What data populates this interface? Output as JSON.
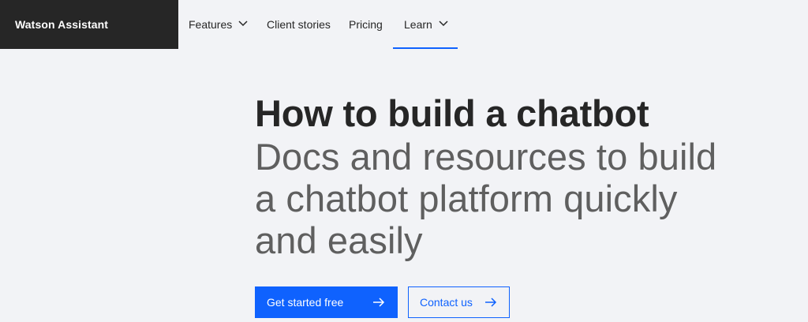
{
  "header": {
    "brand": "Watson Assistant",
    "nav": {
      "features": "Features",
      "client_stories": "Client stories",
      "pricing": "Pricing",
      "learn": "Learn"
    }
  },
  "hero": {
    "title": "How to build a chatbot",
    "subtitle": "Docs and resources to build a chatbot platform quickly and easily"
  },
  "actions": {
    "primary_label": "Get started free",
    "secondary_label": "Contact us"
  },
  "colors": {
    "brand_bar": "#262626",
    "accent": "#0f62fe",
    "background": "#f2f3f6"
  },
  "icons": {
    "dropdown": "chevron-down-icon",
    "button_arrow": "arrow-right-icon"
  }
}
